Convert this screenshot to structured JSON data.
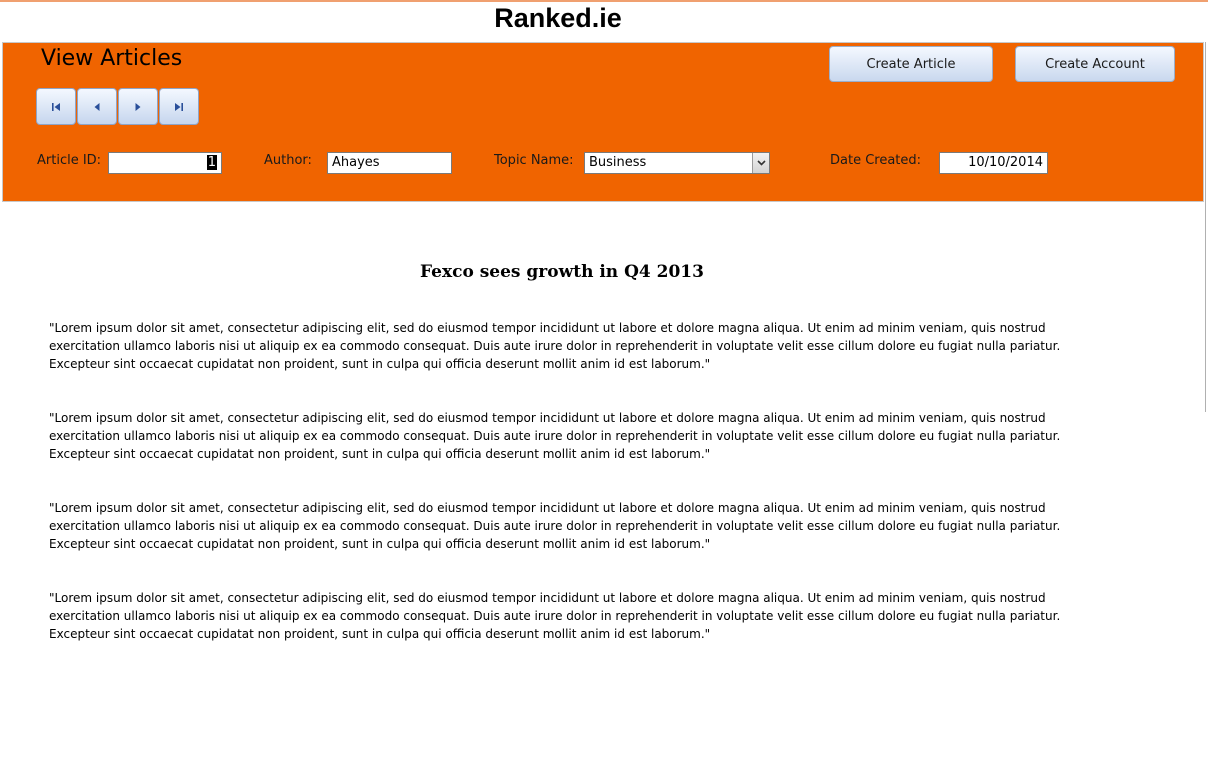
{
  "site": {
    "title": "Ranked.ie"
  },
  "header": {
    "heading": "View Articles",
    "nav_icons": [
      "first-record-icon",
      "previous-record-icon",
      "next-record-icon",
      "last-record-icon"
    ],
    "buttons": {
      "create_article": "Create Article",
      "create_account": "Create Account"
    },
    "fields": {
      "article_id_label": "Article ID:",
      "article_id_value": "1",
      "author_label": "Author:",
      "author_value": "Ahayes",
      "topic_label": "Topic Name:",
      "topic_value": "Business",
      "date_label": "Date Created:",
      "date_value": "10/10/2014"
    }
  },
  "article": {
    "title": "Fexco sees growth in Q4 2013",
    "paragraphs": [
      "\"Lorem ipsum dolor sit amet, consectetur adipiscing elit, sed do eiusmod tempor incididunt ut labore et dolore magna aliqua. Ut enim ad minim veniam, quis nostrud exercitation ullamco laboris nisi ut aliquip ex ea commodo consequat. Duis aute irure dolor in reprehenderit in voluptate velit esse cillum dolore eu fugiat nulla pariatur. Excepteur sint occaecat cupidatat non proident, sunt in culpa qui officia deserunt mollit anim id est laborum.\"",
      "\"Lorem ipsum dolor sit amet, consectetur adipiscing elit, sed do eiusmod tempor incididunt ut labore et dolore magna aliqua. Ut enim ad minim veniam, quis nostrud exercitation ullamco laboris nisi ut aliquip ex ea commodo consequat. Duis aute irure dolor in reprehenderit in voluptate velit esse cillum dolore eu fugiat nulla pariatur. Excepteur sint occaecat cupidatat non proident, sunt in culpa qui officia deserunt mollit anim id est laborum.\"",
      "\"Lorem ipsum dolor sit amet, consectetur adipiscing elit, sed do eiusmod tempor incididunt ut labore et dolore magna aliqua. Ut enim ad minim veniam, quis nostrud exercitation ullamco laboris nisi ut aliquip ex ea commodo consequat. Duis aute irure dolor in reprehenderit in voluptate velit esse cillum dolore eu fugiat nulla pariatur. Excepteur sint occaecat cupidatat non proident, sunt in culpa qui officia deserunt mollit anim id est laborum.\"",
      "\"Lorem ipsum dolor sit amet, consectetur adipiscing elit, sed do eiusmod tempor incididunt ut labore et dolore magna aliqua. Ut enim ad minim veniam, quis nostrud exercitation ullamco laboris nisi ut aliquip ex ea commodo consequat. Duis aute irure dolor in reprehenderit in voluptate velit esse cillum dolore eu fugiat nulla pariatur. Excepteur sint occaecat cupidatat non proident, sunt in culpa qui officia deserunt mollit anim id est laborum.\""
    ]
  },
  "colors": {
    "header_bg": "#f06400",
    "button_gradient_top": "#f4f8ff",
    "button_gradient_bottom": "#c9d8ee"
  }
}
